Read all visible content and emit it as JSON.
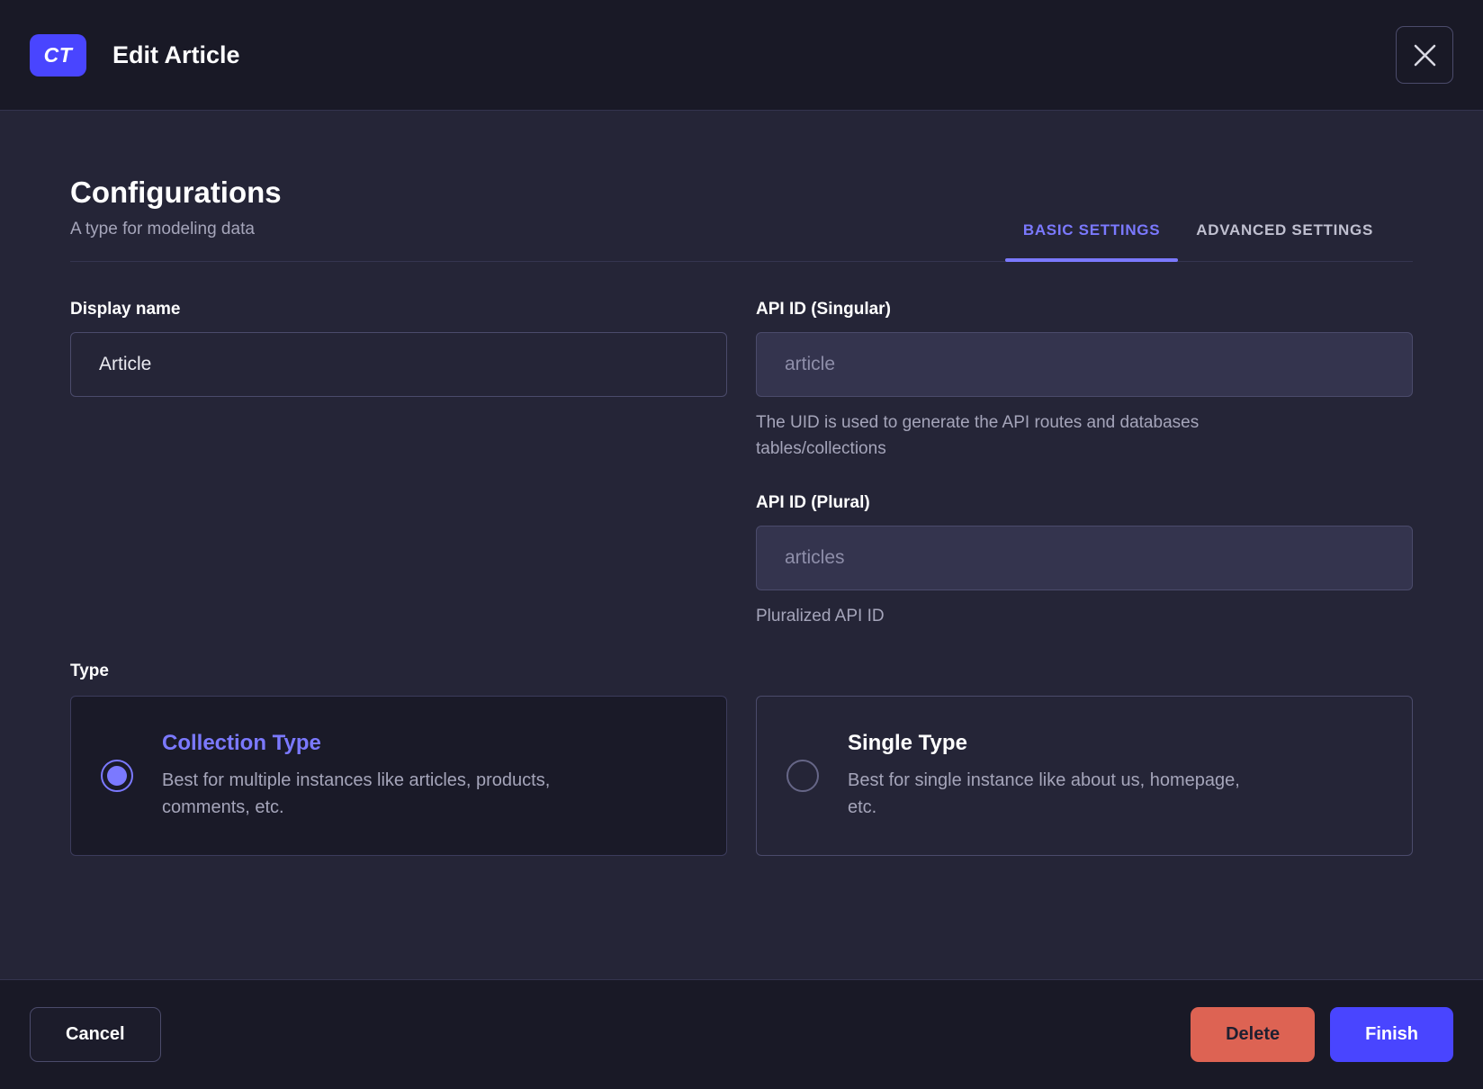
{
  "header": {
    "badge": "CT",
    "title": "Edit Article"
  },
  "section": {
    "title": "Configurations",
    "subtitle": "A type for modeling data",
    "tabs": [
      {
        "label": "BASIC SETTINGS",
        "active": true
      },
      {
        "label": "ADVANCED SETTINGS",
        "active": false
      }
    ]
  },
  "form": {
    "display_name": {
      "label": "Display name",
      "value": "Article"
    },
    "api_id_singular": {
      "label": "API ID (Singular)",
      "value": "article",
      "helper": "The UID is used to generate the API routes and databases\ntables/collections"
    },
    "api_id_plural": {
      "label": "API ID (Plural)",
      "value": "articles",
      "helper": "Pluralized API ID"
    },
    "type": {
      "label": "Type",
      "options": [
        {
          "title": "Collection Type",
          "description": "Best for multiple instances like articles, products,\ncomments, etc.",
          "selected": true
        },
        {
          "title": "Single Type",
          "description": "Best for single instance like about us, homepage,\netc.",
          "selected": false
        }
      ]
    }
  },
  "footer": {
    "cancel_label": "Cancel",
    "delete_label": "Delete",
    "finish_label": "Finish"
  },
  "icons": {
    "close": "close-icon"
  },
  "colors": {
    "primary": "#4945ff",
    "primary_light": "#7b79ff",
    "danger": "#dd6353",
    "header_bg": "#191926",
    "body_bg": "#252537",
    "border": "#4b4b6b",
    "text_muted": "#a5a5ba"
  }
}
